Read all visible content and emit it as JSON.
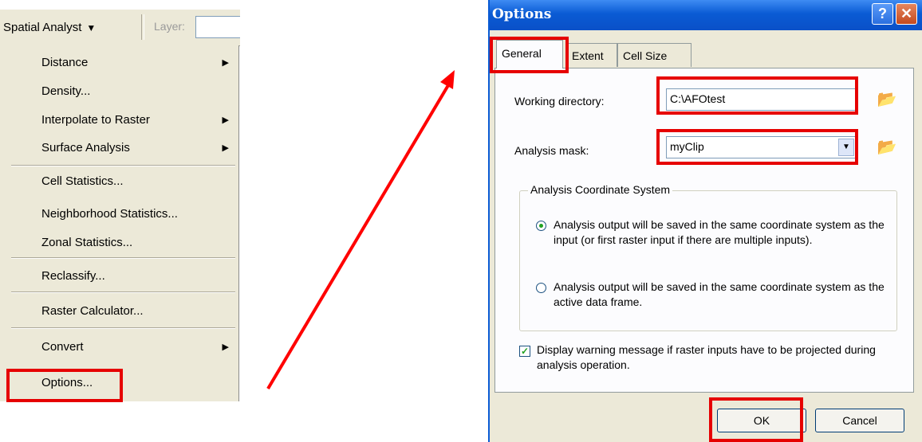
{
  "toolbar": {
    "menu_label": "Spatial Analyst",
    "menu_arrow": "▼",
    "layer_label": "Layer:"
  },
  "menu": {
    "items": [
      {
        "label": "Distance",
        "submenu": true
      },
      {
        "label": "Density...",
        "submenu": false
      },
      {
        "label": "Interpolate to Raster",
        "submenu": true
      },
      {
        "label": "Surface Analysis",
        "submenu": true
      },
      {
        "label": "Cell Statistics...",
        "submenu": false
      },
      {
        "label": "Neighborhood Statistics...",
        "submenu": false
      },
      {
        "label": "Zonal Statistics...",
        "submenu": false
      },
      {
        "label": "Reclassify...",
        "submenu": false
      },
      {
        "label": "Raster Calculator...",
        "submenu": false
      },
      {
        "label": "Convert",
        "submenu": true
      },
      {
        "label": "Options...",
        "submenu": false
      }
    ],
    "submenu_glyph": "▶"
  },
  "dialog": {
    "title": "Options",
    "help_glyph": "?",
    "close_glyph": "✕",
    "tabs": [
      "General",
      "Extent",
      "Cell Size"
    ],
    "active_tab": "General",
    "working_directory_label": "Working directory:",
    "working_directory_value": "C:\\AFOtest",
    "analysis_mask_label": "Analysis mask:",
    "analysis_mask_value": "myClip",
    "coordinate_group_title": "Analysis Coordinate System",
    "radio_option_1": "Analysis output will be saved in the same coordinate system as the input (or first raster input if there are multiple inputs).",
    "radio_option_2": "Analysis output will be saved in the same coordinate system as the active data frame.",
    "selected_radio": 1,
    "warning_checkbox_label": "Display warning message if raster inputs have to be projected during analysis operation.",
    "warning_checkbox_checked": true,
    "ok_label": "OK",
    "cancel_label": "Cancel"
  },
  "colors": {
    "highlight": "#e60000",
    "arrow": "#ff0000",
    "titlebar": "#0a5bd4",
    "menu_bg": "#ece9d8"
  }
}
